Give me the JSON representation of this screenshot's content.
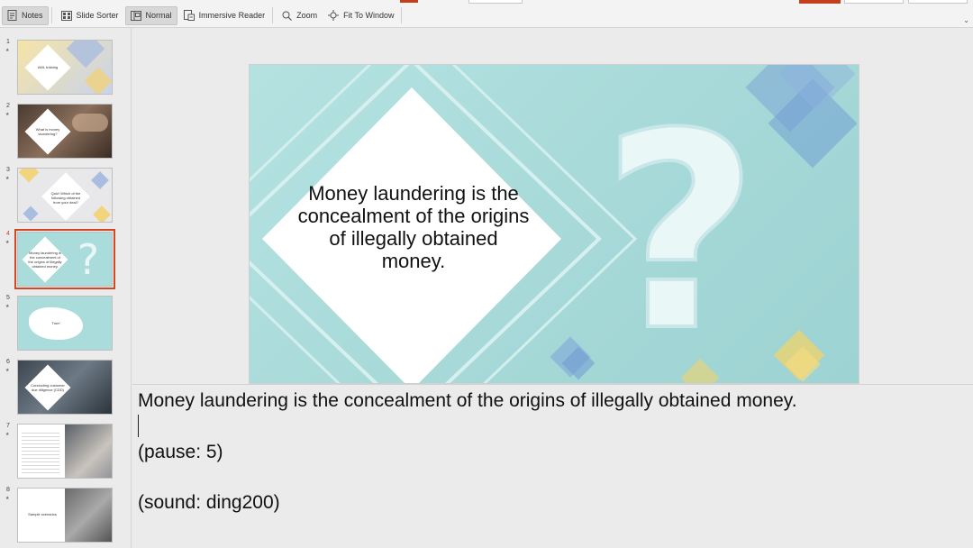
{
  "toolbar": {
    "notes": "Notes",
    "slide_sorter": "Slide Sorter",
    "normal": "Normal",
    "immersive_reader": "Immersive Reader",
    "zoom": "Zoom",
    "fit_to_window": "Fit To Window"
  },
  "thumbnails": [
    {
      "num": "1",
      "text": "AML training"
    },
    {
      "num": "2",
      "text": "What is money laundering?"
    },
    {
      "num": "3",
      "text": "Quiz! Which of the following obtained from your deal?"
    },
    {
      "num": "4",
      "text": "Money laundering is the concealment of the origins of illegally obtained money."
    },
    {
      "num": "5",
      "text": "True!"
    },
    {
      "num": "6",
      "text": "Conducting customer due diligence (CDD)"
    },
    {
      "num": "7",
      "text": ""
    },
    {
      "num": "8",
      "text": "Sample scenarios"
    }
  ],
  "slide": {
    "text": "Money laundering is the concealment of the origins of illegally obtained money."
  },
  "notes": {
    "line1": "Money laundering is the concealment of the origins of illegally obtained money.",
    "line2": "(pause: 5)",
    "line3": "(sound: ding200)"
  },
  "colors": {
    "accent": "#d24726",
    "slide_background": "#a6d9d8"
  }
}
